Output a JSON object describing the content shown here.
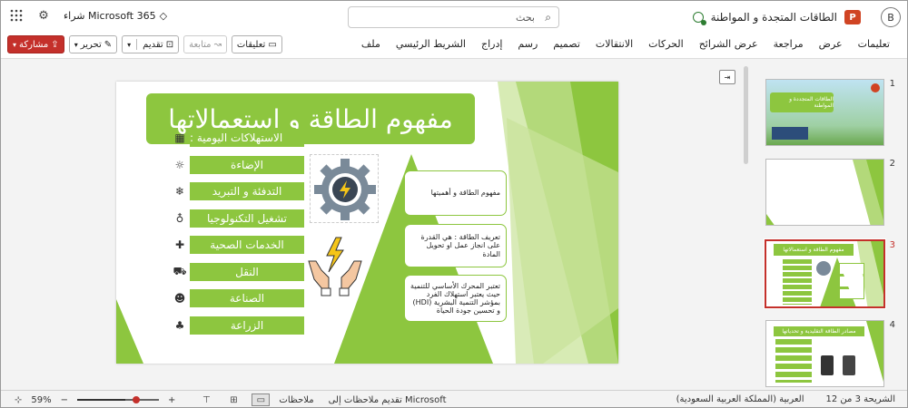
{
  "titlebar": {
    "buy_label": "شراء Microsoft 365",
    "search_placeholder": "بحث",
    "doc_title": "الطاقات المتجدة و المواطنة",
    "app_logo": "P",
    "user_initial": "B"
  },
  "ribbon": {
    "tabs": [
      "ملف",
      "الشريط الرئيسي",
      "إدراج",
      "رسم",
      "تصميم",
      "الانتقالات",
      "الحركات",
      "عرض الشرائح",
      "مراجعة",
      "عرض",
      "تعليمات"
    ],
    "share_label": "مشاركة",
    "edit_label": "تحرير",
    "present_label": "تقديم",
    "follow_label": "متابعة",
    "comments_label": "تعليقات"
  },
  "slide": {
    "title": "مفهوم الطاقة و استعمالاتها",
    "items": [
      "الاستهلاكات اليومية :",
      "الإضاءة",
      "التدفئة و التبريد",
      "تشغيل التكنولوجيا",
      "الخدمات الصحية",
      "النقل",
      "الصناعة",
      "الزراعة"
    ],
    "item_icons": [
      "calculator-icon",
      "lightbulb-icon",
      "snowflake-icon",
      "device-icon",
      "health-icon",
      "truck-icon",
      "worker-icon",
      "plant-icon"
    ],
    "boxes": [
      "مفهوم الطاقة و أهميتها",
      "تعريف الطاقة : هي القدرة على انجاز عمل او تحويل المادة",
      "تعتبر المحرك الأساسي للتنمية حيث يعتبر استهلاك الفرد بمؤشر التنمية البشرية (HDI) و تحسين جودة الحياة"
    ]
  },
  "thumbnails": [
    {
      "num": "1",
      "title": "الطاقات المتجددة و المواطنة"
    },
    {
      "num": "2",
      "title": ""
    },
    {
      "num": "3",
      "title": "مفهوم الطاقة و استعمالاتها"
    },
    {
      "num": "4",
      "title": "مصادر الطاقة التقليدية و تحدياتها"
    }
  ],
  "status": {
    "slide_info": "الشريحة 3 من 12",
    "language": "العربية (المملكة العربية السعودية)",
    "feedback": "تقديم ملاحظات إلى Microsoft",
    "notes": "ملاحظات",
    "zoom": "59%",
    "zoom_level": 0.59
  },
  "colors": {
    "accent": "#8dc63f",
    "brand_red": "#c4302b"
  }
}
